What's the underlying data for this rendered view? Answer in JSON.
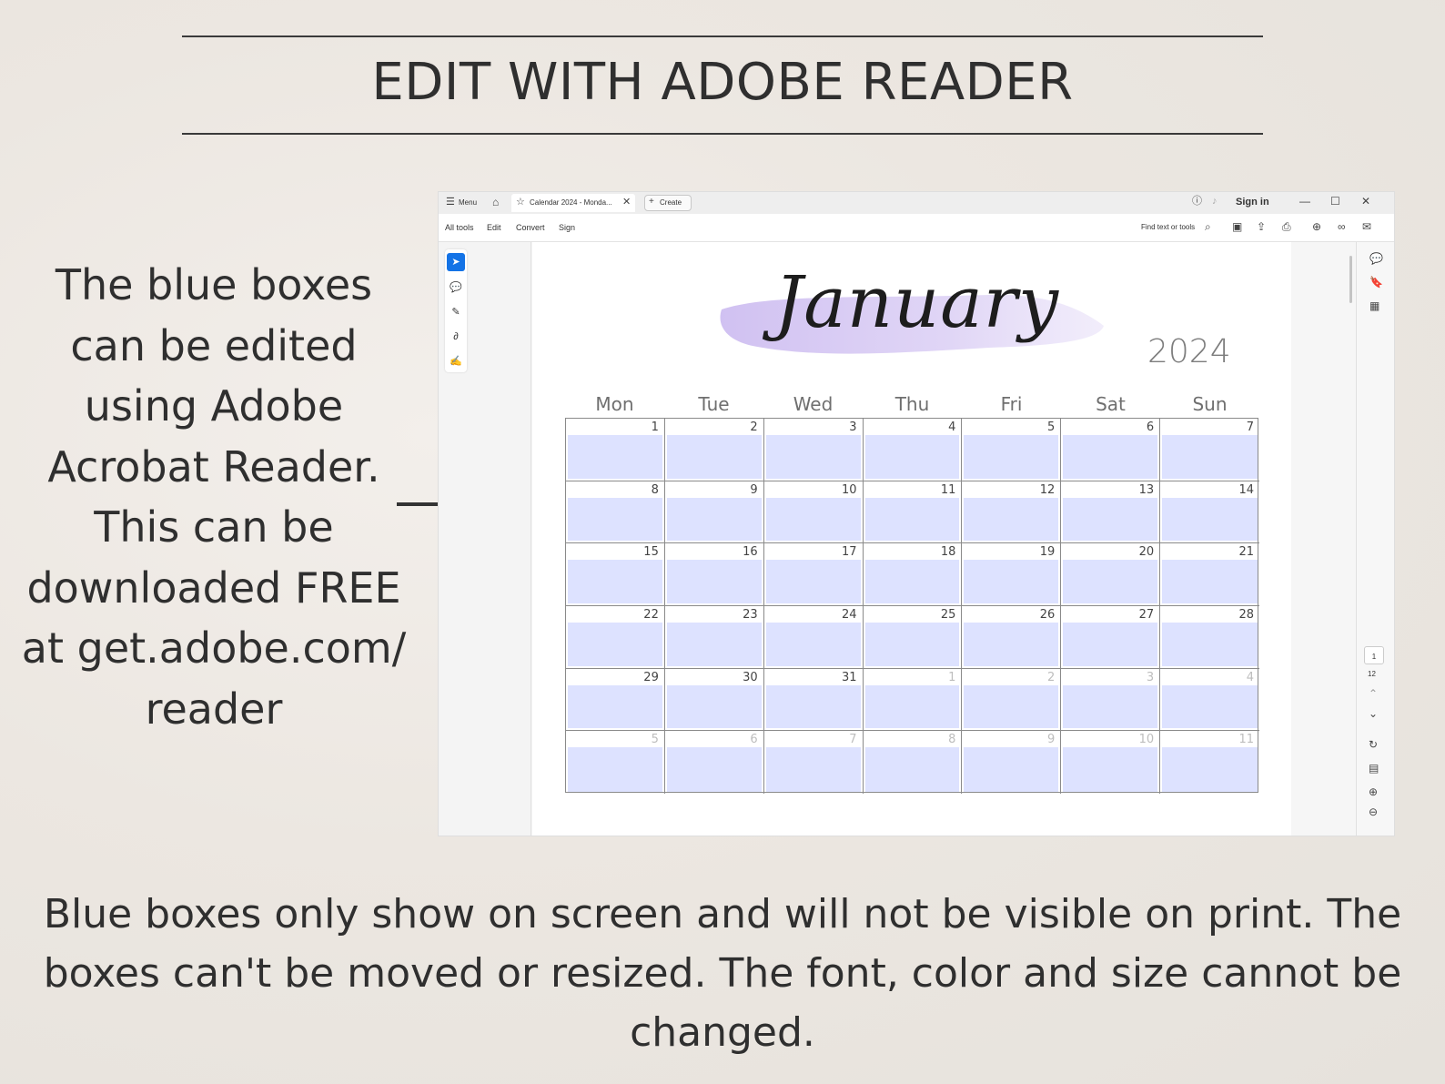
{
  "headline": "EDIT WITH ADOBE READER",
  "left_text_lines": [
    "The blue boxes",
    "can be edited",
    "using Adobe",
    "Acrobat Reader.",
    "This can be",
    "downloaded FREE",
    "at get.adobe.com/",
    "reader"
  ],
  "bottom_text_lines": [
    "Blue boxes only show on screen and will not be visible on print. The",
    "boxes can't be moved or resized. The font, color and size cannot be",
    "changed."
  ],
  "app": {
    "menu_label": "Menu",
    "tab_title": "Calendar 2024 - Monda...",
    "create_label": "Create",
    "sign_in_label": "Sign in",
    "toolbar": {
      "all_tools": "All tools",
      "edit": "Edit",
      "convert": "Convert",
      "sign": "Sign"
    },
    "find_label": "Find text or tools",
    "page_current": "1",
    "page_total": "12",
    "accent_color": "#1473e6"
  },
  "calendar": {
    "month": "January",
    "year": "2024",
    "weekdays": [
      "Mon",
      "Tue",
      "Wed",
      "Thu",
      "Fri",
      "Sat",
      "Sun"
    ],
    "field_color": "#dde2ff",
    "weeks": [
      [
        "1",
        "2",
        "3",
        "4",
        "5",
        "6",
        "7"
      ],
      [
        "8",
        "9",
        "10",
        "11",
        "12",
        "13",
        "14"
      ],
      [
        "15",
        "16",
        "17",
        "18",
        "19",
        "20",
        "21"
      ],
      [
        "22",
        "23",
        "24",
        "25",
        "26",
        "27",
        "28"
      ],
      [
        "29",
        "30",
        "31",
        "1",
        "2",
        "3",
        "4"
      ],
      [
        "5",
        "6",
        "7",
        "8",
        "9",
        "10",
        "11"
      ]
    ],
    "muted_from_index": 31
  }
}
